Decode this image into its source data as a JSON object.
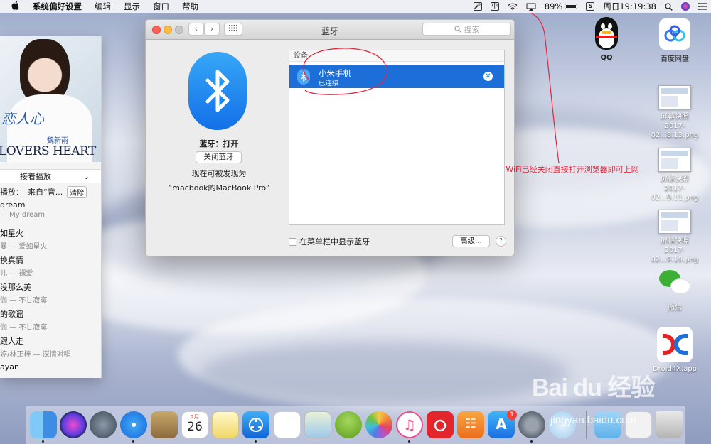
{
  "menubar": {
    "apple": "",
    "app": "系统偏好设置",
    "menus": [
      "编辑",
      "显示",
      "窗口",
      "帮助"
    ],
    "input_method": "中",
    "battery": "89%",
    "clock": "周日19:19:38"
  },
  "mini_player": {
    "album_text_1": "恋人心",
    "album_text_2": "魏新雨",
    "album_text_3": "LOVERS HEART",
    "next_up_label": "接着播放",
    "history_label": "播放：",
    "history_source": "来自“音...",
    "clear_label": "清除",
    "songs": [
      {
        "title": "dream",
        "artist": "— My dream"
      },
      {
        "title": "如星火",
        "artist": "曼 — 爱如星火"
      },
      {
        "title": "换真情",
        "artist": "儿 — 裸爱"
      },
      {
        "title": "没那么美",
        "artist": "伽 — 不甘寂寞"
      },
      {
        "title": "的歌谣",
        "artist": "伽 — 不甘寂寞"
      },
      {
        "title": "跟人走",
        "artist": "婷/林正梓 — 深情对唱"
      },
      {
        "title": "ayan",
        "artist": ""
      }
    ]
  },
  "bluetooth_window": {
    "title": "蓝牙",
    "search_placeholder": "搜索",
    "status": "蓝牙：打开",
    "turn_off_label": "关闭蓝牙",
    "discoverable_label": "现在可被发现为",
    "device_name": "“macbook的MacBook Pro”",
    "devices_header": "设备",
    "devices": [
      {
        "name": "小米手机",
        "status": "已连接"
      }
    ],
    "show_in_menubar_label": "在菜单栏中显示蓝牙",
    "advanced_label": "高级...",
    "help_label": "?"
  },
  "annotation": "WiFi已经关闭直接打开浏览器即可上网",
  "desktop_icons": [
    {
      "label": "QQ"
    },
    {
      "label": "百度网盘"
    },
    {
      "label": "屏幕快照\n2017-02...8.13.png"
    },
    {
      "label": "屏幕快照\n2017-02...9.11.png"
    },
    {
      "label": "屏幕快照\n2017-02...9.19.png"
    },
    {
      "label": "微信"
    },
    {
      "label": "Droid4X.app"
    }
  ],
  "dock": {
    "calendar_month": "2月",
    "calendar_day": "26",
    "appstore_badge": "1"
  },
  "watermark": {
    "main": "Bai du 经验",
    "url": "jingyan.baidu.com"
  }
}
